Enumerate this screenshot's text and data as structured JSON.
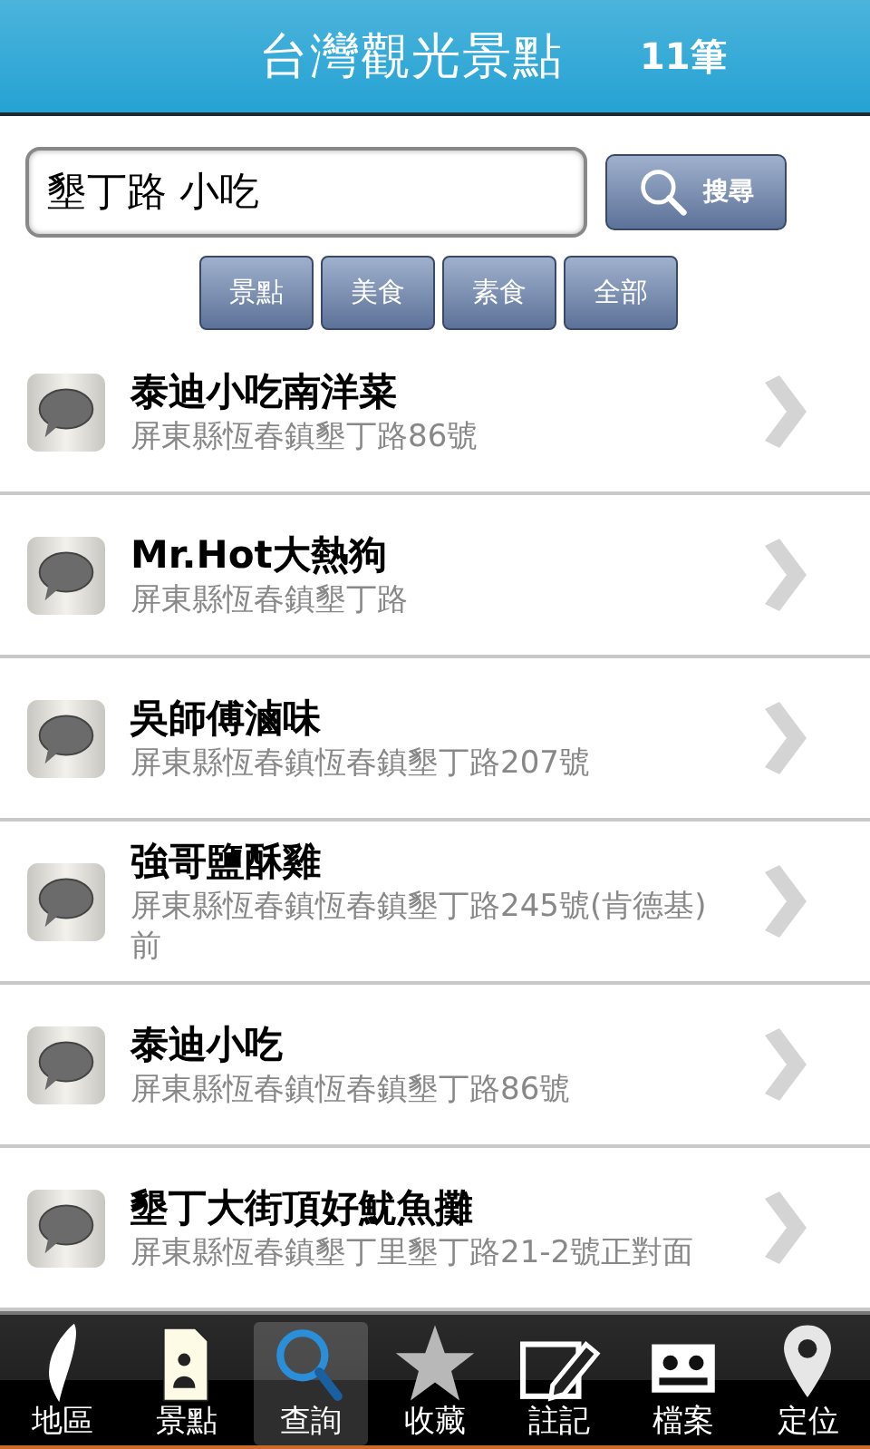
{
  "header": {
    "title": "台灣觀光景點",
    "count": "11筆"
  },
  "search": {
    "value": "墾丁路 小吃",
    "button": "搜尋"
  },
  "filters": [
    {
      "label": "景點"
    },
    {
      "label": "美食"
    },
    {
      "label": "素食"
    },
    {
      "label": "全部"
    }
  ],
  "results": [
    {
      "name": "泰迪小吃南洋菜",
      "address": "屏東縣恆春鎮墾丁路86號"
    },
    {
      "name": "Mr.Hot大熱狗",
      "address": "屏東縣恆春鎮墾丁路"
    },
    {
      "name": "吳師傅滷味",
      "address": "屏東縣恆春鎮恆春鎮墾丁路207號"
    },
    {
      "name": "強哥鹽酥雞",
      "address": "屏東縣恆春鎮恆春鎮墾丁路245號(肯德基)前"
    },
    {
      "name": "泰迪小吃",
      "address": "屏東縣恆春鎮恆春鎮墾丁路86號"
    },
    {
      "name": "墾丁大街頂好魷魚攤",
      "address": "屏東縣恆春鎮墾丁里墾丁路21-2號正對面"
    }
  ],
  "tabbar": [
    {
      "label": "地區",
      "kind": "island",
      "selected": false
    },
    {
      "label": "景點",
      "kind": "person",
      "selected": false
    },
    {
      "label": "查詢",
      "kind": "search",
      "selected": true
    },
    {
      "label": "收藏",
      "kind": "star",
      "selected": false
    },
    {
      "label": "註記",
      "kind": "note",
      "selected": false
    },
    {
      "label": "檔案",
      "kind": "tape",
      "selected": false
    },
    {
      "label": "定位",
      "kind": "pin",
      "selected": false
    }
  ]
}
